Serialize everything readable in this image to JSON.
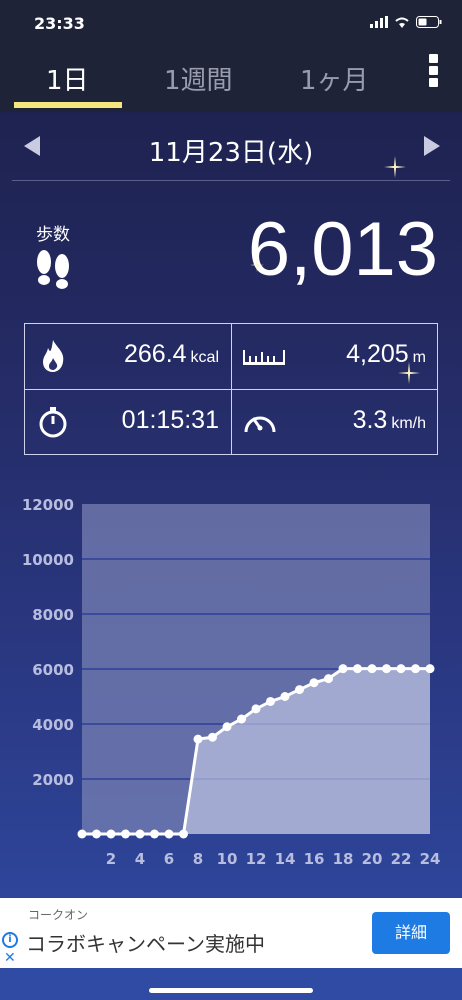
{
  "status": {
    "time": "23:33"
  },
  "tabs": [
    {
      "label": "1日",
      "active": true
    },
    {
      "label": "1週間",
      "active": false
    },
    {
      "label": "1ヶ月",
      "active": false
    }
  ],
  "date": {
    "label": "11月23日(水)"
  },
  "steps": {
    "label": "歩数",
    "value": "6,013"
  },
  "stats": {
    "calories": {
      "value": "266.4",
      "unit": "kcal"
    },
    "distance": {
      "value": "4,205",
      "unit": "m"
    },
    "duration": {
      "value": "01:15:31"
    },
    "speed": {
      "value": "3.3",
      "unit": "km/h"
    }
  },
  "chart_data": {
    "type": "area",
    "x": [
      0,
      1,
      2,
      3,
      4,
      5,
      6,
      7,
      8,
      9,
      10,
      11,
      12,
      13,
      14,
      15,
      16,
      17,
      18,
      19,
      20,
      21,
      22,
      23,
      24
    ],
    "values": [
      0,
      0,
      0,
      0,
      0,
      0,
      0,
      0,
      3450,
      3520,
      3900,
      4180,
      4550,
      4820,
      5000,
      5250,
      5500,
      5650,
      6013,
      6013,
      6013,
      6013,
      6013,
      6013,
      6013
    ],
    "yticks": [
      2000,
      4000,
      6000,
      8000,
      10000,
      12000
    ],
    "xticks": [
      2,
      4,
      6,
      8,
      10,
      12,
      14,
      16,
      18,
      20,
      22,
      24
    ],
    "ylim": [
      0,
      12000
    ],
    "xlim": [
      0,
      24
    ],
    "grid": true
  },
  "ad": {
    "sponsor": "コークオン",
    "title": "コラボキャンペーン実施中",
    "button": "詳細"
  },
  "colors": {
    "accent": "#f6e67f",
    "ad_button": "#1e7be4"
  }
}
